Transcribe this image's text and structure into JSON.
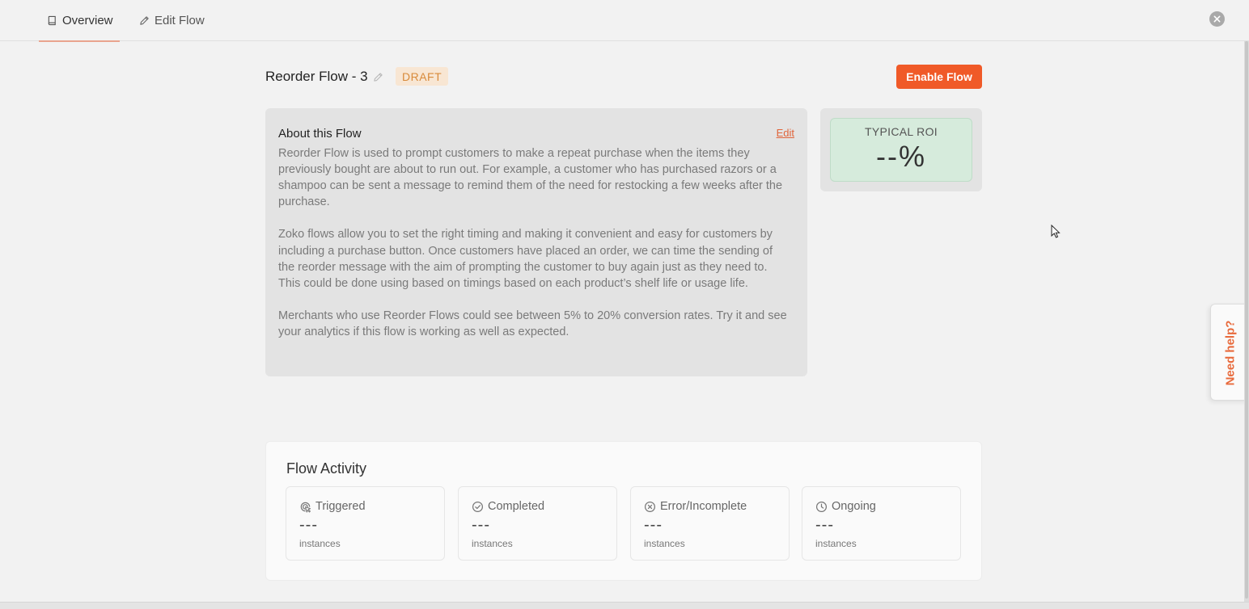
{
  "tabs": [
    {
      "label": "Overview",
      "icon": "book-icon",
      "active": true
    },
    {
      "label": "Edit Flow",
      "icon": "pencil-icon",
      "active": false
    }
  ],
  "flow": {
    "title": "Reorder Flow - 3",
    "status": "DRAFT",
    "enable_label": "Enable Flow"
  },
  "about": {
    "title": "About this Flow",
    "edit_label": "Edit",
    "paragraphs": [
      "Reorder Flow is used to prompt customers to make a repeat purchase when the items they previously bought are about to run out. For example, a customer who has purchased razors or a shampoo can be sent a message to remind them of the need for restocking a few weeks after the purchase.",
      "Zoko flows allow you to set the right timing and making it convenient and easy for customers by including a purchase button. Once customers have placed an order, we can time the sending of the reorder message with the aim of prompting the customer to buy again just as they need to. This could be done using based on timings based on each product’s shelf life or usage life.",
      "Merchants who use Reorder Flows could see between 5% to 20% conversion rates. Try it and see your analytics if this flow is working as well as expected."
    ]
  },
  "roi": {
    "label": "TYPICAL ROI",
    "value": "--%"
  },
  "help": {
    "label": "Need help?"
  },
  "activity": {
    "title": "Flow Activity",
    "stats": [
      {
        "label": "Triggered",
        "icon": "cursor-click-icon",
        "value": "---",
        "unit": "instances"
      },
      {
        "label": "Completed",
        "icon": "check-circle-icon",
        "value": "---",
        "unit": "instances"
      },
      {
        "label": "Error/Incomplete",
        "icon": "x-circle-icon",
        "value": "---",
        "unit": "instances"
      },
      {
        "label": "Ongoing",
        "icon": "clock-icon",
        "value": "---",
        "unit": "instances"
      }
    ]
  },
  "colors": {
    "accent": "#f05a28",
    "draft_badge_bg": "#f8e6d3",
    "draft_badge_text": "#d88a3a",
    "roi_bg": "#d6ebdc"
  }
}
